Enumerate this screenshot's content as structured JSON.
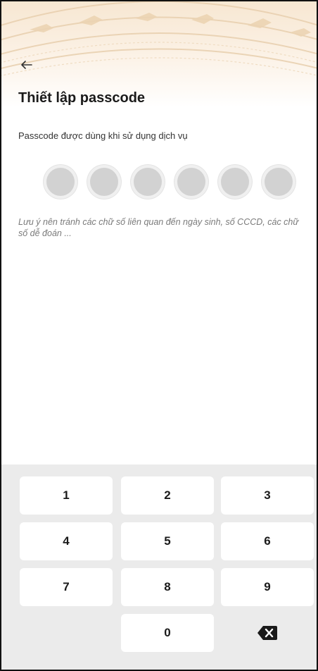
{
  "header": {
    "title": "Thiết lập passcode",
    "back_icon": "arrow-left-icon"
  },
  "subtitle": "Passcode được dùng khi sử dụng dịch vụ",
  "passcode": {
    "length": 6,
    "filled": 0
  },
  "note": "Lưu ý nên tránh các chữ số liên quan đến ngày sinh, số CCCD, các chữ số dễ đoán ...",
  "keypad": {
    "keys": [
      "1",
      "2",
      "3",
      "4",
      "5",
      "6",
      "7",
      "8",
      "9",
      "0"
    ],
    "delete_icon": "backspace-icon"
  },
  "colors": {
    "banner": "#f7e7d2",
    "dot": "#d2d2d2",
    "keypad_bg": "#ebebeb",
    "text": "#1a1a1a"
  }
}
